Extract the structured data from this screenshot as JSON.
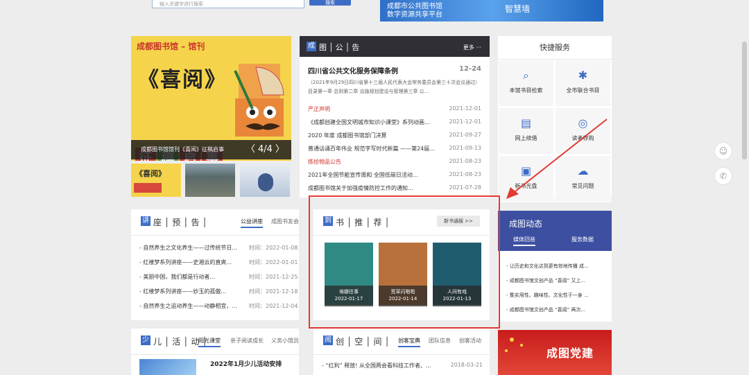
{
  "top": {
    "search_placeholder": "输入关键字进行搜索",
    "search_button": "搜索",
    "banner_line1": "成都市公共图书馆",
    "banner_line2": "数字资源共享平台",
    "banner_right": "智慧墙"
  },
  "magazine": {
    "title": "成都图书馆 – 馆刊",
    "big_title": "《喜阅》",
    "signs": [
      "征",
      "稿",
      "启",
      "事"
    ],
    "caption": "成都图书馆馆刊《喜阅》征稿启事",
    "page": "〈 4/4 〉",
    "thumb1_text": "《喜阅》"
  },
  "announcements": {
    "tag": "成",
    "title": "图│公│告",
    "more": "更多 ···",
    "top_title": "四川省公共文化服务保障条例",
    "top_date": "12-24",
    "top_desc": "（2021年9月29日四川省第十三届人民代表大会常务委员会第三十次会议通过）目录第一章 总则第二章 设施规划建设与管理第三章 公...",
    "items": [
      {
        "title": "严正声明",
        "date": "2021-12-01",
        "red": true
      },
      {
        "title": "《成都创建全国文明城市知识小课堂》系列动画...",
        "date": "2021-12-01",
        "red": false
      },
      {
        "title": "2020 年度 成都图书馆部门决算",
        "date": "2021-09-27",
        "red": false
      },
      {
        "title": "普通话诵百年伟业 规范字写时代新篇 ——第24届...",
        "date": "2021-09-13",
        "red": false
      },
      {
        "title": "拣拾物品公告",
        "date": "2021-08-23",
        "red": true
      },
      {
        "title": "2021年全国节能宣传周和 全国低碳日活动...",
        "date": "2021-08-23",
        "red": false
      },
      {
        "title": "成都图书馆关于加强疫情防控工作的通知...",
        "date": "2021-07-28",
        "red": false
      }
    ]
  },
  "quick": {
    "title": "快捷服务",
    "cells": [
      {
        "label": "本馆书目检索",
        "icon": "⌕"
      },
      {
        "label": "全市联合书目",
        "icon": "✱"
      },
      {
        "label": "网上续借",
        "icon": "▤"
      },
      {
        "label": "读者荐购",
        "icon": "◎"
      },
      {
        "label": "新书光盘",
        "icon": "▣"
      },
      {
        "label": "常见问题",
        "icon": "☁"
      }
    ]
  },
  "lecture": {
    "tag": "讲",
    "title": "座│预│告│",
    "tab1": "公益讲座",
    "tab2": "成图书友会",
    "items": [
      {
        "title": "- 自然养生之文化养生——过传统节日...",
        "date": "时间：2022-01-08"
      },
      {
        "title": "- 红楼梦系列讲座——史湘云的直爽...",
        "date": "时间：2022-01-01"
      },
      {
        "title": "- 美丽中国，我们都是行动者...",
        "date": "时间：2021-12-25"
      },
      {
        "title": "- 红楼梦系列讲座——妙玉的孤傲...",
        "date": "时间：2021-12-18"
      },
      {
        "title": "- 自然养生之运动养生——动静相宜，...",
        "date": "时间：2021-12-04"
      }
    ]
  },
  "books": {
    "tag": "到",
    "title": "书│推│荐│",
    "new_button": "新书通报 >>",
    "items": [
      {
        "name": "埃娜往事",
        "date": "2022-01-17",
        "color": "#2f8a86"
      },
      {
        "name": "荒草闪啪啦",
        "date": "2022-01-14",
        "color": "#b8713a"
      },
      {
        "name": "人间有戏",
        "date": "2022-01-13",
        "color": "#1f5d6e"
      }
    ]
  },
  "dynamics": {
    "title": "成图动态",
    "tab1": "媒体回音",
    "tab2": "服务数据",
    "items": [
      "- 让历史和文化达到更有效地传播 成...",
      "- 成都图书馆文创产品 “喜阅” 又上...",
      "- 集实用性、趣味性、文化性于一身 ...",
      "- 成都图书馆文创产品 “喜阅” 再次..."
    ]
  },
  "kids": {
    "tag": "少",
    "title": "儿│活│动│",
    "tab1": "阳光课堂",
    "tab2": "亲子阅读成长",
    "tab3": "义务小馆员",
    "news": "2022年1月少儿活动安排"
  },
  "creative": {
    "tag": "阅",
    "title": "创│空│间│",
    "tab1": "创客宝典",
    "tab2": "团队信息",
    "tab3": "创客活动",
    "item": "- “红利” 释放! 从全国两会看科技工作者、...",
    "date": "2018-03-21"
  },
  "party": {
    "title": "成图党建"
  },
  "float": {
    "chat": "☺",
    "phone": "✆"
  },
  "colors": {
    "accent": "#3d6cc6",
    "highlight": "#e23a32",
    "red_text": "#d0342c"
  }
}
